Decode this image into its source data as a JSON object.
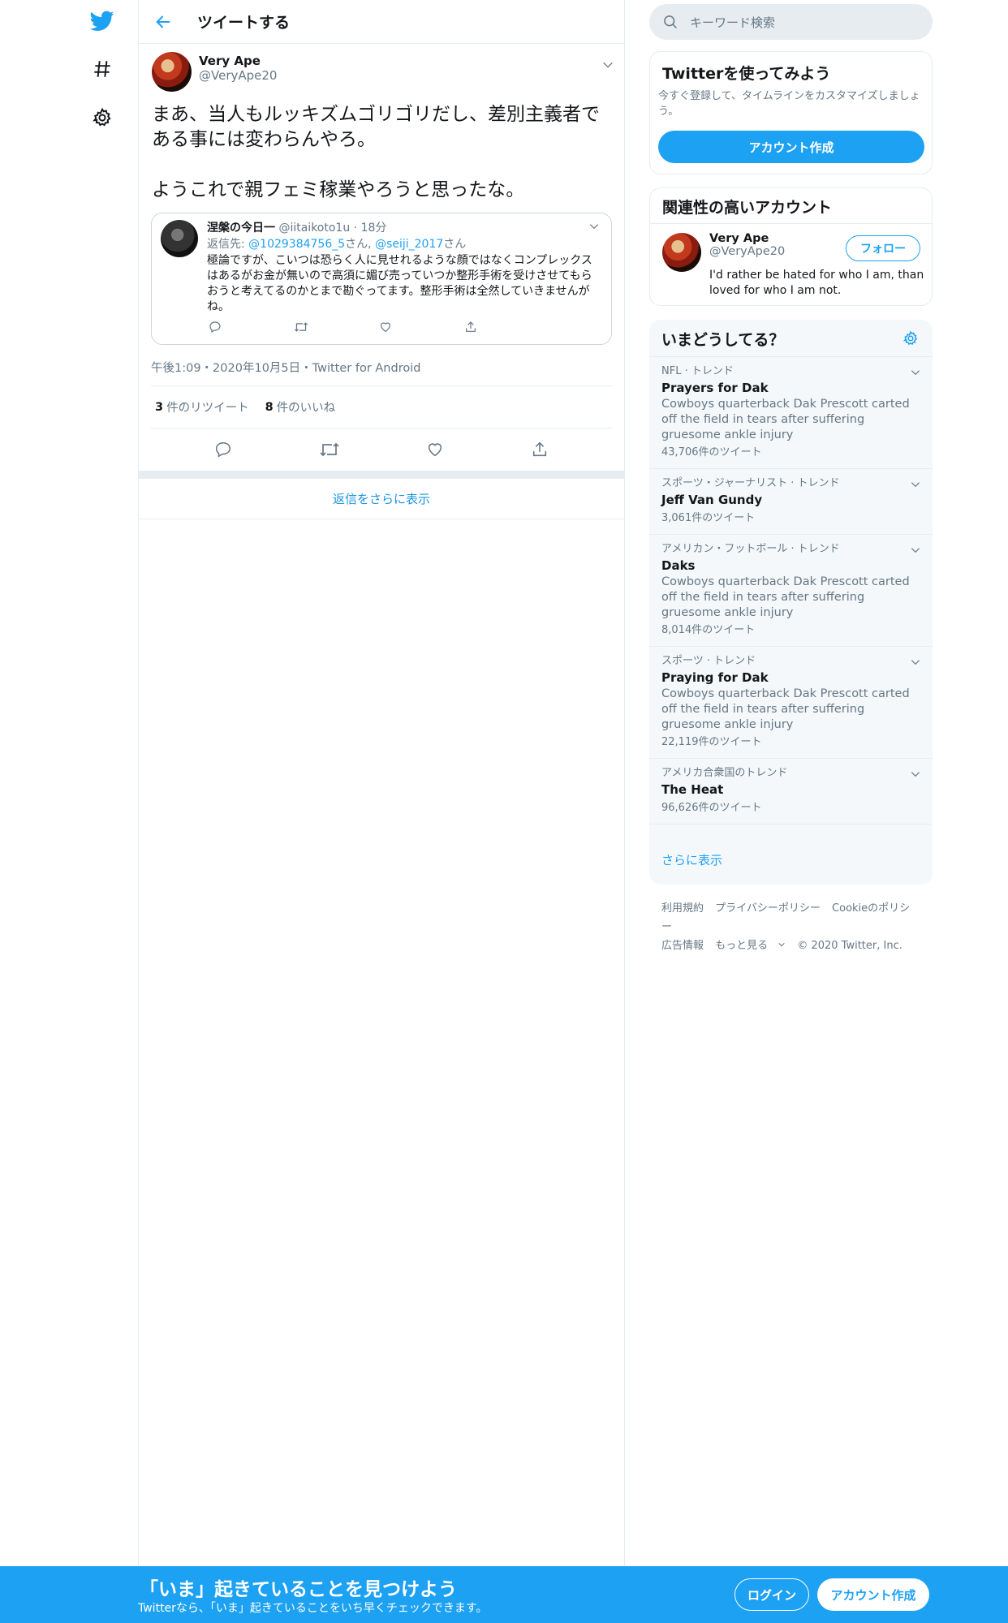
{
  "header": {
    "title": "ツイートする"
  },
  "tweet": {
    "name": "Very Ape",
    "handle": "@VeryApe20",
    "text": "まあ、当人もルッキズムゴリゴリだし、差別主義者である事には変わらんやろ。\n\nようこれで親フェミ稼業やろうと思ったな。",
    "meta": "午後1:09・2020年10月5日・Twitter for Android",
    "retweets": "3",
    "retweets_label": "件のリツイート",
    "likes": "8",
    "likes_label": "件のいいね",
    "more_replies": "返信をさらに表示"
  },
  "quote": {
    "name": "涅槃の今日一",
    "handle": "@iitaikoto1u",
    "time": "18分",
    "reply_prefix": "返信先: ",
    "reply_to_1": "@1029384756_5",
    "reply_suffix_1": "さん, ",
    "reply_to_2": "@seiji_2017",
    "reply_suffix_2": "さん",
    "text": "極論ですが、こいつは恐らく人に見せれるような顔ではなくコンプレックスはあるがお金が無いので高須に媚び売っていつか整形手術を受けさせてもらおうと考えてるのかとまで勘ぐってます。整形手術は全然していきませんがね。"
  },
  "search": {
    "placeholder": "キーワード検索"
  },
  "signup_card": {
    "title": "Twitterを使ってみよう",
    "desc": "今すぐ登録して、タイムラインをカスタマイズしましょう。",
    "button": "アカウント作成"
  },
  "related": {
    "title": "関連性の高いアカウント",
    "name": "Very Ape",
    "handle": "@VeryApe20",
    "follow": "フォロー",
    "bio": "I'd rather be hated for who I am, than loved for who I am not."
  },
  "trends": {
    "title": "いまどうしてる？",
    "items": [
      {
        "context": "NFL · トレンド",
        "name": "Prayers for Dak",
        "desc": "Cowboys quarterback Dak Prescott carted off the field in tears after suffering gruesome ankle injury",
        "count": "43,706件のツイート"
      },
      {
        "context": "スポーツ・ジャーナリスト · トレンド",
        "name": "Jeff Van Gundy",
        "desc": "",
        "count": "3,061件のツイート"
      },
      {
        "context": "アメリカン・フットボール · トレンド",
        "name": "Daks",
        "desc": "Cowboys quarterback Dak Prescott carted off the field in tears after suffering gruesome ankle injury",
        "count": "8,014件のツイート"
      },
      {
        "context": "スポーツ · トレンド",
        "name": "Praying for Dak",
        "desc": "Cowboys quarterback Dak Prescott carted off the field in tears after suffering gruesome ankle injury",
        "count": "22,119件のツイート"
      },
      {
        "context": "アメリカ合衆国のトレンド",
        "name": "The Heat",
        "desc": "",
        "count": "96,626件のツイート"
      }
    ],
    "more": "さらに表示"
  },
  "footer": {
    "terms": "利用規約",
    "privacy": "プライバシーポリシー",
    "cookie": "Cookieのポリシー",
    "ads": "広告情報",
    "more": "もっと見る",
    "copyright": "© 2020 Twitter, Inc."
  },
  "bottom_bar": {
    "title": "「いま」起きていることを見つけよう",
    "subtitle": "Twitterなら、「いま」起きていることをいち早くチェックできます。",
    "login": "ログイン",
    "signup": "アカウント作成"
  },
  "colors": {
    "accent": "#1da1f2",
    "text": "#14171a",
    "muted": "#657786",
    "border": "#e6ecf0"
  }
}
